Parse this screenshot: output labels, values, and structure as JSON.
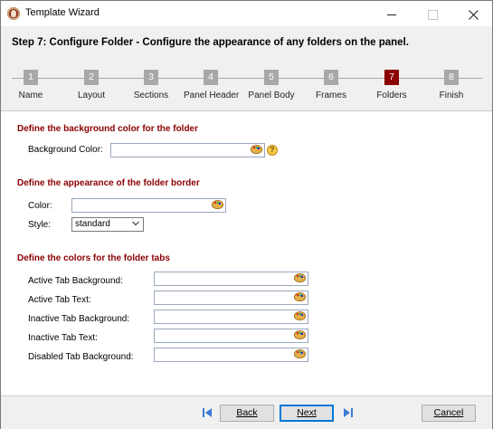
{
  "window": {
    "title": "Template Wizard",
    "app_icon": "template-wizard-icon"
  },
  "header": {
    "step_title": "Step 7: Configure Folder - Configure the appearance of any folders on the panel.",
    "steps": [
      {
        "num": "1",
        "label": "Name"
      },
      {
        "num": "2",
        "label": "Layout"
      },
      {
        "num": "3",
        "label": "Sections"
      },
      {
        "num": "4",
        "label": "Panel Header"
      },
      {
        "num": "5",
        "label": "Panel Body"
      },
      {
        "num": "6",
        "label": "Frames"
      },
      {
        "num": "7",
        "label": "Folders"
      },
      {
        "num": "8",
        "label": "Finish"
      }
    ],
    "active_step": 7,
    "active_color": "#8b0000"
  },
  "background": {
    "heading": "Define the background color for the folder",
    "label": "Background Color:",
    "value": ""
  },
  "border": {
    "heading": "Define the appearance of the folder border",
    "color_label": "Color:",
    "color_value": "",
    "style_label": "Style:",
    "style_value": "standard"
  },
  "tabs": {
    "heading": "Define the colors for the folder tabs",
    "fields": [
      {
        "label": "Active Tab Background:",
        "value": ""
      },
      {
        "label": "Active Tab Text:",
        "value": ""
      },
      {
        "label": "Inactive Tab Background:",
        "value": ""
      },
      {
        "label": "Inactive Tab Text:",
        "value": ""
      },
      {
        "label": "Disabled Tab Background:",
        "value": ""
      }
    ]
  },
  "footer": {
    "back_label": "Back",
    "next_label": "Next",
    "cancel_label": "Cancel",
    "first_icon": "first-page-icon",
    "last_icon": "last-page-icon"
  },
  "colors": {
    "heading": "#8b0000",
    "step_inactive": "#a8a8a8"
  }
}
